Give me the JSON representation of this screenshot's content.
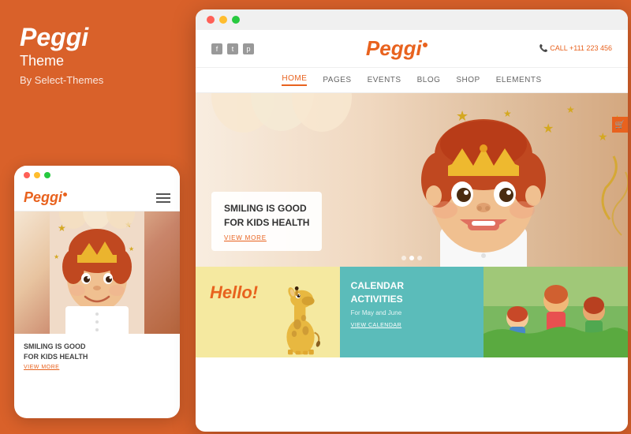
{
  "brand": {
    "name": "Peggi",
    "subtitle": "Theme",
    "author": "By Select-Themes"
  },
  "desktop": {
    "top_bar": {
      "dots": [
        "red",
        "yellow",
        "green"
      ]
    },
    "header": {
      "social": [
        "f",
        "t",
        "p"
      ],
      "logo": "Peggi",
      "call_label": "CALL",
      "call_number": "+111 223 456"
    },
    "nav": {
      "items": [
        "HOME",
        "PAGES",
        "EVENTS",
        "BLOG",
        "SHOP",
        "ELEMENTS"
      ],
      "active": "HOME"
    },
    "hero": {
      "heading": "SMILING IS GOOD\nFOR KIDS HEALTH",
      "view_more": "VIEW MORE"
    },
    "cards": [
      {
        "type": "giraffe",
        "hello_text": "Hello!"
      },
      {
        "type": "calendar",
        "title": "CALENDAR ACTIVITIES",
        "subtitle": "For May and June",
        "link": "VIEW CALENDAR"
      },
      {
        "type": "photo"
      }
    ]
  },
  "mobile": {
    "top_bar": {
      "dots": [
        "red",
        "yellow",
        "green"
      ]
    },
    "logo": "Peggi",
    "hero": {
      "heading": "SMILING IS GOOD\nFOR KIDS HEALTH",
      "view_more": "VIEW MORE"
    }
  },
  "colors": {
    "accent": "#e8621e",
    "background": "#d9612a",
    "teal": "#5bbcba",
    "yellow_bg": "#f5e9a0"
  }
}
